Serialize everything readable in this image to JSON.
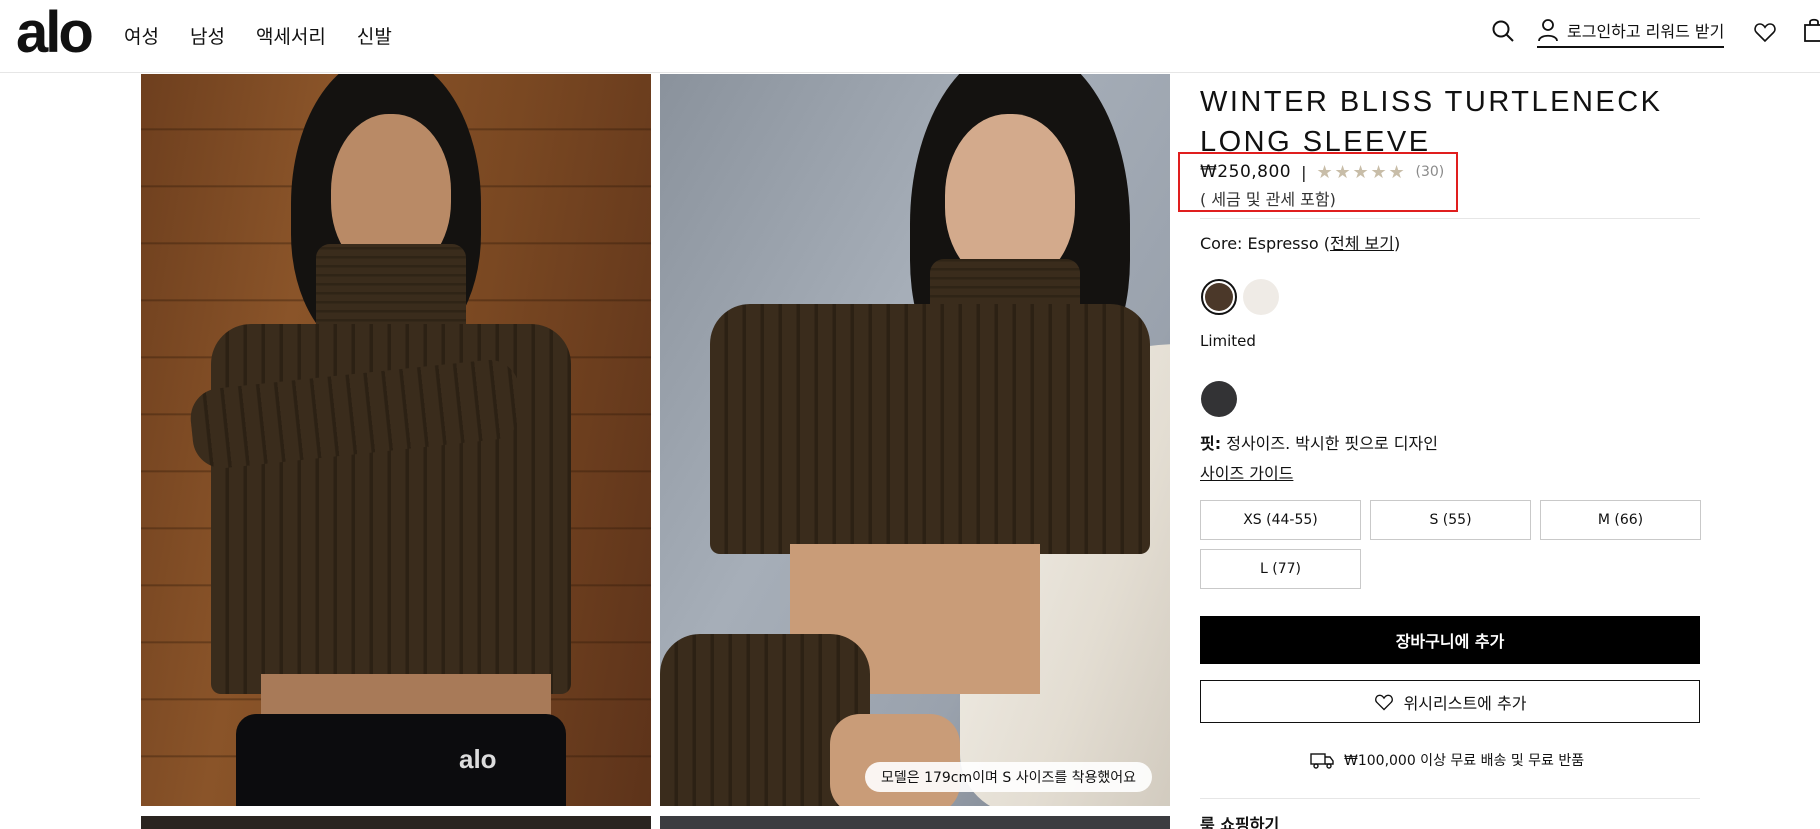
{
  "header": {
    "logo": "alo",
    "nav": [
      "여성",
      "남성",
      "액세서리",
      "신발"
    ],
    "login_label": "로그인하고 리워드 받기",
    "icons": [
      "search-icon",
      "user-icon",
      "heart-icon",
      "bag-icon"
    ]
  },
  "gallery": {
    "photo2_caption": "모델은 179cm이며 S 사이즈를 착용했어요",
    "photo1_waistband_logo": "alo"
  },
  "product": {
    "title": "WINTER BLISS TURTLENECK LONG SLEEVE",
    "price": "₩250,800",
    "separator": "|",
    "rating_stars": 5,
    "review_count": "(30)",
    "tax_note": "( 세금 및 관세 포함)",
    "color_prefix": "Core: Espresso (",
    "color_link": "전체 보기",
    "color_suffix": ")",
    "swatches_core": [
      {
        "name": "Espresso",
        "color": "#4b3829",
        "selected": true
      },
      {
        "name": "Ivory",
        "color": "#efebe6",
        "selected": false
      }
    ],
    "limited_label": "Limited",
    "swatches_limited": [
      {
        "name": "Charcoal",
        "color": "#333335",
        "selected": false
      }
    ],
    "fit_label": "핏:",
    "fit_text": "정사이즈. 박시한 핏으로 디자인",
    "size_guide": "사이즈 가이드",
    "sizes": [
      "XS (44-55)",
      "S (55)",
      "M (66)",
      "L (77)"
    ],
    "add_to_cart": "장바구니에 추가",
    "add_to_wishlist": "위시리스트에 추가",
    "shipping_note": "₩100,000 이상 무료 배송 및 무료 반품",
    "shop_the_look": "룩 쇼핑하기"
  },
  "colors": {
    "accent": "#000000",
    "highlight_box": "#e01e1e",
    "star": "#c8bda8"
  }
}
